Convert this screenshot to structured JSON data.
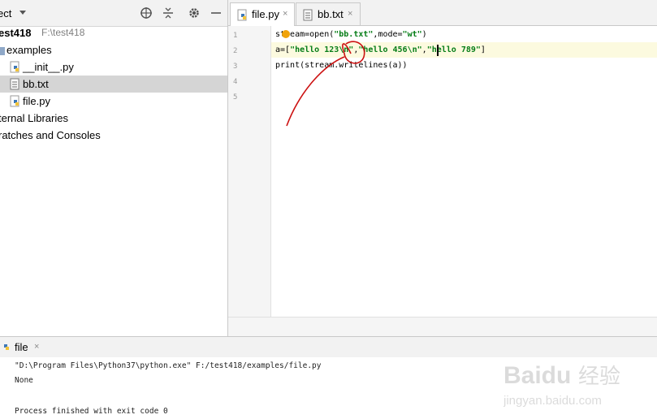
{
  "project": {
    "title": "ect",
    "root": {
      "name": "est418",
      "path": "F:\\test418"
    },
    "tree": [
      {
        "label": "examples"
      },
      {
        "label": "__init__.py"
      },
      {
        "label": "bb.txt"
      },
      {
        "label": "file.py"
      },
      {
        "label": "ternal Libraries"
      },
      {
        "label": "ratches and Consoles"
      }
    ]
  },
  "toolbar": {
    "icons": [
      "crosshair-icon",
      "collapse-icon",
      "gear-icon",
      "minimize-icon"
    ]
  },
  "tabs": [
    {
      "label": "file.py",
      "close": "×",
      "active": true
    },
    {
      "label": "bb.txt",
      "close": "×",
      "active": false
    }
  ],
  "editor": {
    "line_numbers": [
      "1",
      "2",
      "3",
      "4",
      "5"
    ],
    "lines": [
      {
        "parts": [
          {
            "t": "stream=open("
          },
          {
            "t": "\"bb.txt\"",
            "s": 1
          },
          {
            "t": ",mode="
          },
          {
            "t": "\"wt\"",
            "s": 1
          },
          {
            "t": ")"
          }
        ]
      },
      {
        "parts": [
          {
            "t": "a=["
          },
          {
            "t": "\"hello 123\\n\"",
            "s": 1
          },
          {
            "t": ","
          },
          {
            "t": "\"hello 456\\n\"",
            "s": 1
          },
          {
            "t": ","
          },
          {
            "t": "\"hello 789\"",
            "s": 1
          },
          {
            "t": "]"
          }
        ]
      },
      {
        "parts": [
          {
            "t": "print(stream.writelines(a))"
          }
        ]
      }
    ]
  },
  "run": {
    "tab_label": "file",
    "close": "×",
    "output": [
      "\"D:\\Program Files\\Python37\\python.exe\" F:/test418/examples/file.py",
      "None",
      "",
      "Process finished with exit code 0"
    ]
  },
  "watermark": {
    "brand": "Baidu",
    "cn": "经验",
    "url": "jingyan.baidu.com"
  },
  "colors": {
    "string": "#067d17",
    "selection": "#d5d5d5",
    "current_line": "#fcfadf",
    "annotation": "#cc1111"
  }
}
